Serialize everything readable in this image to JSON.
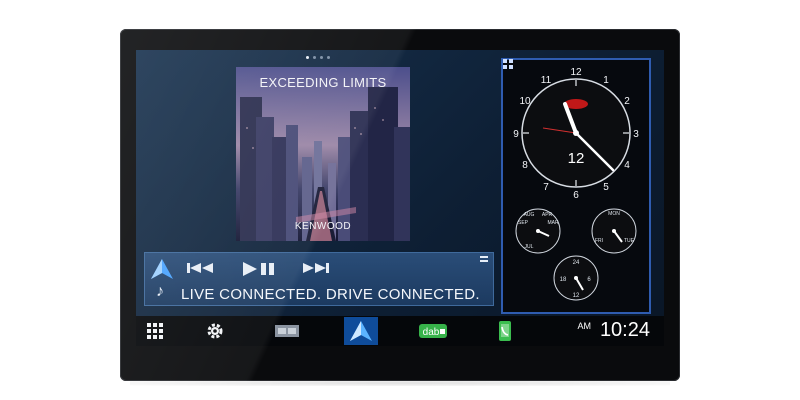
{
  "device": {
    "accent_color": "#2f5cb0",
    "background": "#ffffff"
  },
  "home": {
    "page_dots": 4,
    "active_dot": 0
  },
  "album": {
    "title": "EXCEEDING LIMITS",
    "brand": "KENWOOD"
  },
  "player": {
    "song_text": "LIVE CONNECTED. DRIVE CONNECTED.",
    "icons": [
      "navigation-icon",
      "previous-track-icon",
      "play-pause-icon",
      "next-track-icon",
      "music-note-icon",
      "menu-icon"
    ]
  },
  "clock_widget": {
    "icon": "widget-grid-icon",
    "main_dial_numbers": [
      "12",
      "1",
      "2",
      "3",
      "4",
      "5",
      "6",
      "7",
      "8",
      "9",
      "10",
      "11"
    ],
    "date_dial_labels": [
      "SEP",
      "AUG",
      "APR",
      "MAR",
      "JUL"
    ],
    "weekday_dial_labels": [
      "MON",
      "FRI",
      "TUE"
    ],
    "hour24_dial_labels": [
      "24",
      "18",
      "6",
      "12"
    ]
  },
  "dock": {
    "items": [
      "apps-grid-icon",
      "settings-gear-icon",
      "media-source-icon",
      "android-auto-icon",
      "dab-radio-icon",
      "phone-icon"
    ],
    "dab_label": "dab",
    "ampm": "AM",
    "time": "10:24"
  }
}
